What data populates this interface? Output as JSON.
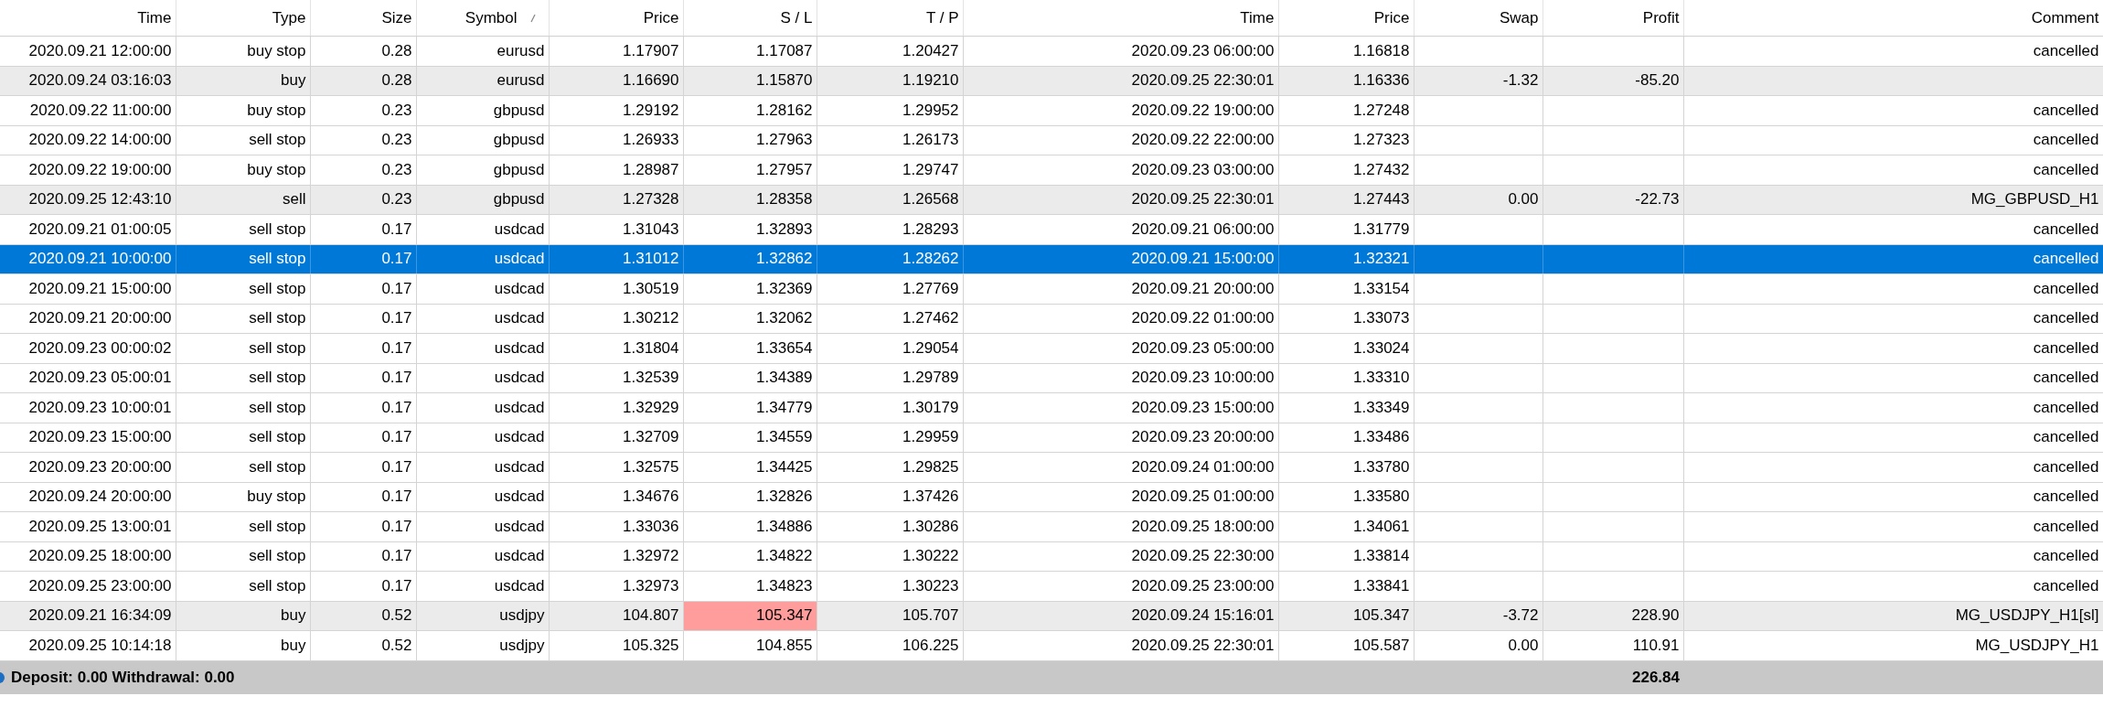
{
  "table": {
    "columns": [
      {
        "label": "Time",
        "sorted": false
      },
      {
        "label": "Type",
        "sorted": false
      },
      {
        "label": "Size",
        "sorted": false
      },
      {
        "label": "Symbol",
        "sorted": true
      },
      {
        "label": "Price",
        "sorted": false
      },
      {
        "label": "S / L",
        "sorted": false
      },
      {
        "label": "T / P",
        "sorted": false
      },
      {
        "label": "Time",
        "sorted": false
      },
      {
        "label": "Price",
        "sorted": false
      },
      {
        "label": "Swap",
        "sorted": false
      },
      {
        "label": "Profit",
        "sorted": false
      },
      {
        "label": "Comment",
        "sorted": false
      }
    ],
    "rows": [
      {
        "cells": [
          "2020.09.21 12:00:00",
          "buy stop",
          "0.28",
          "eurusd",
          "1.17907",
          "1.17087",
          "1.20427",
          "2020.09.23 06:00:00",
          "1.16818",
          null,
          null,
          "cancelled"
        ],
        "shaded": false,
        "selected": false,
        "sl_alert": false
      },
      {
        "cells": [
          "2020.09.24 03:16:03",
          "buy",
          "0.28",
          "eurusd",
          "1.16690",
          "1.15870",
          "1.19210",
          "2020.09.25 22:30:01",
          "1.16336",
          "-1.32",
          "-85.20",
          null
        ],
        "shaded": true,
        "selected": false,
        "sl_alert": false
      },
      {
        "cells": [
          "2020.09.22 11:00:00",
          "buy stop",
          "0.23",
          "gbpusd",
          "1.29192",
          "1.28162",
          "1.29952",
          "2020.09.22 19:00:00",
          "1.27248",
          null,
          null,
          "cancelled"
        ],
        "shaded": false,
        "selected": false,
        "sl_alert": false
      },
      {
        "cells": [
          "2020.09.22 14:00:00",
          "sell stop",
          "0.23",
          "gbpusd",
          "1.26933",
          "1.27963",
          "1.26173",
          "2020.09.22 22:00:00",
          "1.27323",
          null,
          null,
          "cancelled"
        ],
        "shaded": false,
        "selected": false,
        "sl_alert": false
      },
      {
        "cells": [
          "2020.09.22 19:00:00",
          "buy stop",
          "0.23",
          "gbpusd",
          "1.28987",
          "1.27957",
          "1.29747",
          "2020.09.23 03:00:00",
          "1.27432",
          null,
          null,
          "cancelled"
        ],
        "shaded": false,
        "selected": false,
        "sl_alert": false
      },
      {
        "cells": [
          "2020.09.25 12:43:10",
          "sell",
          "0.23",
          "gbpusd",
          "1.27328",
          "1.28358",
          "1.26568",
          "2020.09.25 22:30:01",
          "1.27443",
          "0.00",
          "-22.73",
          "MG_GBPUSD_H1"
        ],
        "shaded": true,
        "selected": false,
        "sl_alert": false
      },
      {
        "cells": [
          "2020.09.21 01:00:05",
          "sell stop",
          "0.17",
          "usdcad",
          "1.31043",
          "1.32893",
          "1.28293",
          "2020.09.21 06:00:00",
          "1.31779",
          null,
          null,
          "cancelled"
        ],
        "shaded": false,
        "selected": false,
        "sl_alert": false
      },
      {
        "cells": [
          "2020.09.21 10:00:00",
          "sell stop",
          "0.17",
          "usdcad",
          "1.31012",
          "1.32862",
          "1.28262",
          "2020.09.21 15:00:00",
          "1.32321",
          null,
          null,
          "cancelled"
        ],
        "shaded": false,
        "selected": true,
        "sl_alert": false
      },
      {
        "cells": [
          "2020.09.21 15:00:00",
          "sell stop",
          "0.17",
          "usdcad",
          "1.30519",
          "1.32369",
          "1.27769",
          "2020.09.21 20:00:00",
          "1.33154",
          null,
          null,
          "cancelled"
        ],
        "shaded": false,
        "selected": false,
        "sl_alert": false
      },
      {
        "cells": [
          "2020.09.21 20:00:00",
          "sell stop",
          "0.17",
          "usdcad",
          "1.30212",
          "1.32062",
          "1.27462",
          "2020.09.22 01:00:00",
          "1.33073",
          null,
          null,
          "cancelled"
        ],
        "shaded": false,
        "selected": false,
        "sl_alert": false
      },
      {
        "cells": [
          "2020.09.23 00:00:02",
          "sell stop",
          "0.17",
          "usdcad",
          "1.31804",
          "1.33654",
          "1.29054",
          "2020.09.23 05:00:00",
          "1.33024",
          null,
          null,
          "cancelled"
        ],
        "shaded": false,
        "selected": false,
        "sl_alert": false
      },
      {
        "cells": [
          "2020.09.23 05:00:01",
          "sell stop",
          "0.17",
          "usdcad",
          "1.32539",
          "1.34389",
          "1.29789",
          "2020.09.23 10:00:00",
          "1.33310",
          null,
          null,
          "cancelled"
        ],
        "shaded": false,
        "selected": false,
        "sl_alert": false
      },
      {
        "cells": [
          "2020.09.23 10:00:01",
          "sell stop",
          "0.17",
          "usdcad",
          "1.32929",
          "1.34779",
          "1.30179",
          "2020.09.23 15:00:00",
          "1.33349",
          null,
          null,
          "cancelled"
        ],
        "shaded": false,
        "selected": false,
        "sl_alert": false
      },
      {
        "cells": [
          "2020.09.23 15:00:00",
          "sell stop",
          "0.17",
          "usdcad",
          "1.32709",
          "1.34559",
          "1.29959",
          "2020.09.23 20:00:00",
          "1.33486",
          null,
          null,
          "cancelled"
        ],
        "shaded": false,
        "selected": false,
        "sl_alert": false
      },
      {
        "cells": [
          "2020.09.23 20:00:00",
          "sell stop",
          "0.17",
          "usdcad",
          "1.32575",
          "1.34425",
          "1.29825",
          "2020.09.24 01:00:00",
          "1.33780",
          null,
          null,
          "cancelled"
        ],
        "shaded": false,
        "selected": false,
        "sl_alert": false
      },
      {
        "cells": [
          "2020.09.24 20:00:00",
          "buy stop",
          "0.17",
          "usdcad",
          "1.34676",
          "1.32826",
          "1.37426",
          "2020.09.25 01:00:00",
          "1.33580",
          null,
          null,
          "cancelled"
        ],
        "shaded": false,
        "selected": false,
        "sl_alert": false
      },
      {
        "cells": [
          "2020.09.25 13:00:01",
          "sell stop",
          "0.17",
          "usdcad",
          "1.33036",
          "1.34886",
          "1.30286",
          "2020.09.25 18:00:00",
          "1.34061",
          null,
          null,
          "cancelled"
        ],
        "shaded": false,
        "selected": false,
        "sl_alert": false
      },
      {
        "cells": [
          "2020.09.25 18:00:00",
          "sell stop",
          "0.17",
          "usdcad",
          "1.32972",
          "1.34822",
          "1.30222",
          "2020.09.25 22:30:00",
          "1.33814",
          null,
          null,
          "cancelled"
        ],
        "shaded": false,
        "selected": false,
        "sl_alert": false
      },
      {
        "cells": [
          "2020.09.25 23:00:00",
          "sell stop",
          "0.17",
          "usdcad",
          "1.32973",
          "1.34823",
          "1.30223",
          "2020.09.25 23:00:00",
          "1.33841",
          null,
          null,
          "cancelled"
        ],
        "shaded": false,
        "selected": false,
        "sl_alert": false
      },
      {
        "cells": [
          "2020.09.21 16:34:09",
          "buy",
          "0.52",
          "usdjpy",
          "104.807",
          "105.347",
          "105.707",
          "2020.09.24 15:16:01",
          "105.347",
          "-3.72",
          "228.90",
          "MG_USDJPY_H1[sl]"
        ],
        "shaded": true,
        "selected": false,
        "sl_alert": true
      },
      {
        "cells": [
          "2020.09.25 10:14:18",
          "buy",
          "0.52",
          "usdjpy",
          "105.325",
          "104.855",
          "106.225",
          "2020.09.25 22:30:01",
          "105.587",
          "0.00",
          "110.91",
          "MG_USDJPY_H1"
        ],
        "shaded": false,
        "selected": false,
        "sl_alert": false
      }
    ]
  },
  "status_bar": {
    "summary": "Deposit: 0.00  Withdrawal: 0.00",
    "total_profit": "226.84"
  }
}
